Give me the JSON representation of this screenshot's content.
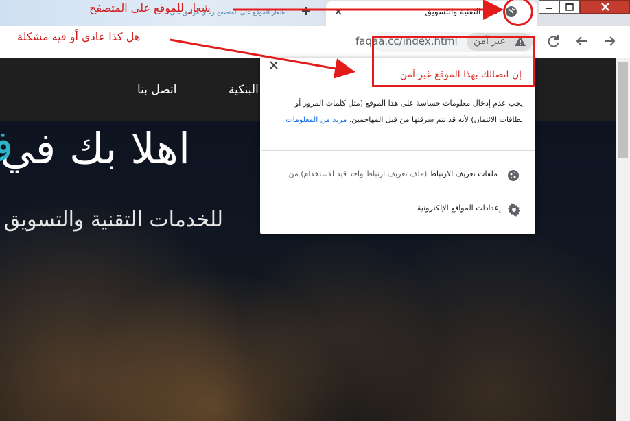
{
  "browser": {
    "background_tab_text": "شعار للموقع على المتصفح رعاي مرافق على",
    "tab_title": "فعاء التقنية والتسويق",
    "omnibox": {
      "url": "faqaa.cc/index.html",
      "security_label": "غير آمن"
    }
  },
  "page": {
    "nav": {
      "contact": "اتصل بنا",
      "partial_item": "البنكية"
    },
    "hero": {
      "title": "اهلا بك في",
      "accent_char": "ف",
      "subtitle": "للخدمات التقنية والتسويق ال"
    }
  },
  "popup": {
    "heading": "إن اتصالك بهذا الموقع غير آمن",
    "description": "يجب عدم إدخال معلومات حساسة على هذا الموقع (مثل كلمات المرور أو بطاقات الائتمان) لأنه قد تتم سرقتها من قِبل المهاجمين.",
    "learn_more": "مزيد من المعلومات",
    "cookies_label": "ملفات تعريف الارتباط",
    "cookies_count": "(ملف تعريف ارتباط واحد قيد الاستخدام) من",
    "site_settings": "إعدادات المواقع الإلكترونية"
  },
  "annotations": {
    "logo_note": "شعار للموقع على المتصفح",
    "question": "هل كذا عادي أو قيه مشكلة",
    "color": "#e21b1b"
  }
}
